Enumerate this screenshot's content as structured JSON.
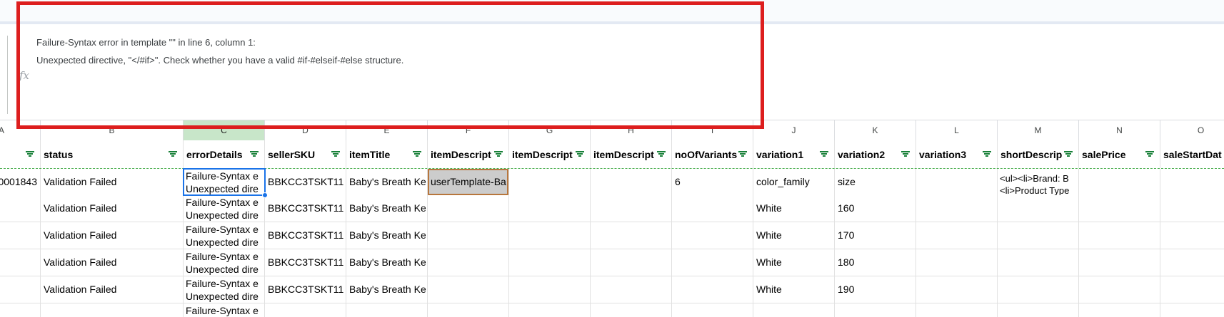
{
  "formula_bar": {
    "fx_label": "fx",
    "line1": "Failure-Syntax error in template \"\" in line 6, column 1:",
    "line2": "Unexpected directive, \"</#if>\". Check whether you have a valid #if-#elseif-#else structure."
  },
  "column_letters": [
    "A",
    "B",
    "C",
    "D",
    "E",
    "F",
    "G",
    "H",
    "I",
    "J",
    "K",
    "L",
    "M",
    "N",
    "O"
  ],
  "highlighted_column": "C",
  "headers": [
    "",
    "status",
    "errorDetails",
    "sellerSKU",
    "itemTitle",
    "itemDescript",
    "itemDescript",
    "itemDescript",
    "noOfVariants",
    "variation1",
    "variation2",
    "variation3",
    "shortDescrip",
    "salePrice",
    "saleStartDat"
  ],
  "rows": [
    [
      "0001843",
      "Validation Failed",
      [
        "Failure-Syntax e",
        "Unexpected dire"
      ],
      "BBKCC3TSKT11",
      "Baby's Breath Ke",
      "userTemplate-Ba",
      "",
      "",
      "6",
      "color_family",
      "size",
      "",
      [
        "<ul><li>Brand: B",
        "<li>Product Type"
      ],
      "",
      ""
    ],
    [
      "",
      "Validation Failed",
      [
        "Failure-Syntax e",
        "Unexpected dire"
      ],
      "BBKCC3TSKT11",
      "Baby's Breath Ke",
      "",
      "",
      "",
      "",
      "White",
      "160",
      "",
      "",
      "",
      ""
    ],
    [
      "",
      "Validation Failed",
      [
        "Failure-Syntax e",
        "Unexpected dire"
      ],
      "BBKCC3TSKT11",
      "Baby's Breath Ke",
      "",
      "",
      "",
      "",
      "White",
      "170",
      "",
      "",
      "",
      ""
    ],
    [
      "",
      "Validation Failed",
      [
        "Failure-Syntax e",
        "Unexpected dire"
      ],
      "BBKCC3TSKT11",
      "Baby's Breath Ke",
      "",
      "",
      "",
      "",
      "White",
      "180",
      "",
      "",
      "",
      ""
    ],
    [
      "",
      "Validation Failed",
      [
        "Failure-Syntax e",
        "Unexpected dire"
      ],
      "BBKCC3TSKT11",
      "Baby's Breath Ke",
      "",
      "",
      "",
      "",
      "White",
      "190",
      "",
      "",
      "",
      ""
    ],
    [
      "",
      "",
      [
        "Failure-Syntax e",
        ""
      ],
      "",
      "",
      "",
      "",
      "",
      "",
      "",
      "",
      "",
      "",
      "",
      ""
    ]
  ],
  "colors": {
    "annotation": "#dd1e1e",
    "selection": "#1a73e8",
    "filter": "#188038",
    "highlight_header": "#c8e6c9"
  }
}
